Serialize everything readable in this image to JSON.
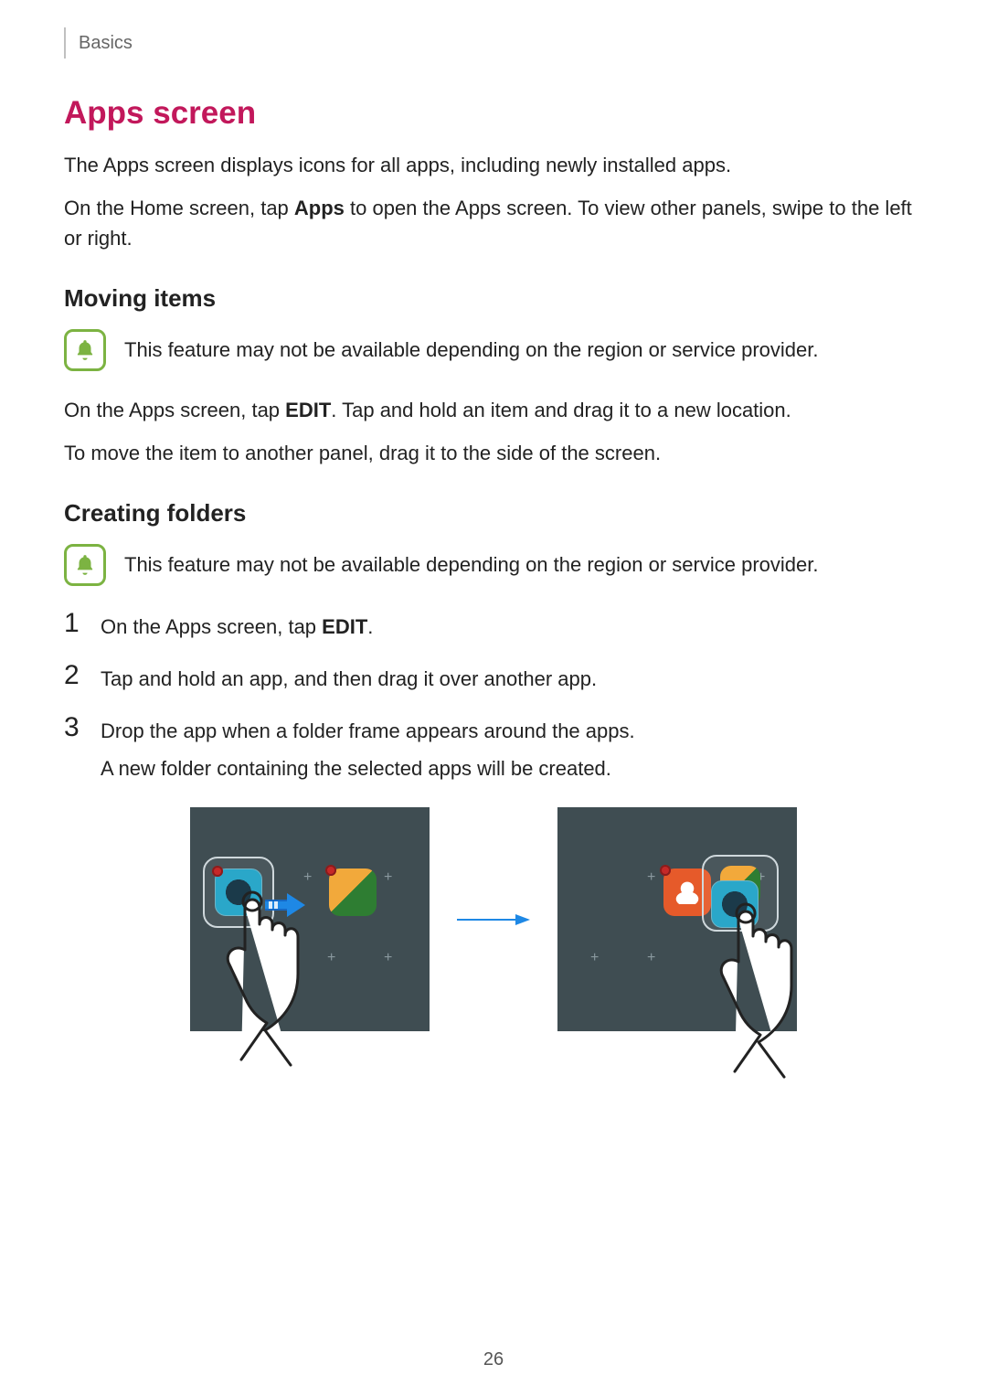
{
  "header": {
    "section": "Basics"
  },
  "title": "Apps screen",
  "intro1": "The Apps screen displays icons for all apps, including newly installed apps.",
  "intro2_before": "On the Home screen, tap ",
  "intro2_bold": "Apps",
  "intro2_after": " to open the Apps screen. To view other panels, swipe to the left or right.",
  "moving": {
    "heading": "Moving items",
    "note": "This feature may not be available depending on the region or service provider.",
    "p1_before": "On the Apps screen, tap ",
    "p1_bold": "EDIT",
    "p1_after": ". Tap and hold an item and drag it to a new location.",
    "p2": "To move the item to another panel, drag it to the side of the screen."
  },
  "creating": {
    "heading": "Creating folders",
    "note": "This feature may not be available depending on the region or service provider.",
    "steps": {
      "s1_num": "1",
      "s1_before": "On the Apps screen, tap ",
      "s1_bold": "EDIT",
      "s1_after": ".",
      "s2_num": "2",
      "s2": "Tap and hold an app, and then drag it over another app.",
      "s3_num": "3",
      "s3": "Drop the app when a folder frame appears around the apps.",
      "s3_sub": "A new folder containing the selected apps will be created."
    }
  },
  "page_number": "26",
  "icons": {
    "note": "bell-icon",
    "camera": "camera-icon",
    "gallery": "gallery-icon",
    "contacts": "contacts-icon",
    "drag_arrow": "drag-right-arrow-icon",
    "transition_arrow": "arrow-right-icon",
    "hand": "hand-pointer-icon"
  }
}
